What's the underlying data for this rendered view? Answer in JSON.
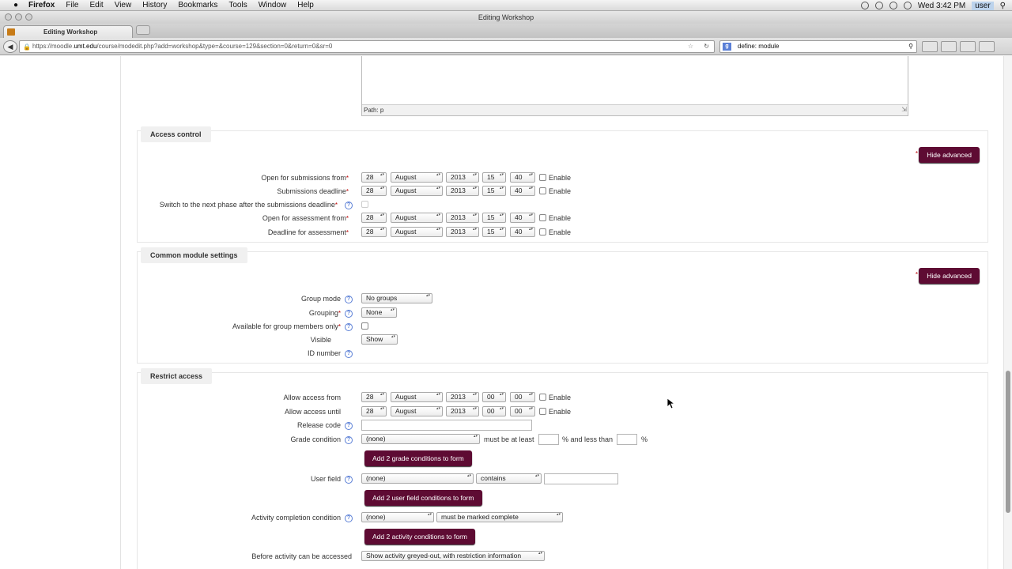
{
  "menubar": {
    "app": "Firefox",
    "items": [
      "File",
      "Edit",
      "View",
      "History",
      "Bookmarks",
      "Tools",
      "Window",
      "Help"
    ],
    "clock": "Wed 3:42 PM",
    "user": "user"
  },
  "window": {
    "title": "Editing Workshop"
  },
  "tab": {
    "title": "Editing Workshop"
  },
  "nav": {
    "url_prefix": "https://moodle.",
    "url_host": "umt.edu",
    "url_rest": "/course/modedit.php?add=workshop&type=&course=129&section=0&return=0&sr=0",
    "search_value": "define: module"
  },
  "editor": {
    "path": "Path: p"
  },
  "access_control": {
    "legend": "Access control",
    "hide_advanced": "Hide advanced",
    "rows": [
      {
        "label": "Open for submissions from",
        "day": "28",
        "month": "August",
        "year": "2013",
        "hour": "15",
        "minute": "40",
        "enable": "Enable"
      },
      {
        "label": "Submissions deadline",
        "day": "28",
        "month": "August",
        "year": "2013",
        "hour": "15",
        "minute": "40",
        "enable": "Enable"
      },
      {
        "label": "Open for assessment from",
        "day": "28",
        "month": "August",
        "year": "2013",
        "hour": "15",
        "minute": "40",
        "enable": "Enable"
      },
      {
        "label": "Deadline for assessment",
        "day": "28",
        "month": "August",
        "year": "2013",
        "hour": "15",
        "minute": "40",
        "enable": "Enable"
      }
    ],
    "switch_label": "Switch to the next phase after the submissions deadline"
  },
  "common": {
    "legend": "Common module settings",
    "hide_advanced": "Hide advanced",
    "group_mode_label": "Group mode",
    "group_mode_value": "No groups",
    "grouping_label": "Grouping",
    "grouping_value": "None",
    "members_only_label": "Available for group members only",
    "visible_label": "Visible",
    "visible_value": "Show",
    "id_number_label": "ID number"
  },
  "restrict": {
    "legend": "Restrict access",
    "from_label": "Allow access from",
    "from": {
      "day": "28",
      "month": "August",
      "year": "2013",
      "hour": "00",
      "minute": "00",
      "enable": "Enable"
    },
    "until_label": "Allow access until",
    "until": {
      "day": "28",
      "month": "August",
      "year": "2013",
      "hour": "00",
      "minute": "00",
      "enable": "Enable"
    },
    "release_code_label": "Release code",
    "grade_condition_label": "Grade condition",
    "grade_condition_value": "(none)",
    "must_be_at_least": "must be at least",
    "and_less_than": "% and less than",
    "percent": "%",
    "add_grade_button": "Add 2 grade conditions to form",
    "user_field_label": "User field",
    "user_field_value": "(none)",
    "user_field_op": "contains",
    "add_user_field_button": "Add 2 user field conditions to form",
    "activity_completion_label": "Activity completion condition",
    "activity_completion_value": "(none)",
    "activity_completion_state": "must be marked complete",
    "add_activity_button": "Add 2 activity conditions to form",
    "before_label": "Before activity can be accessed",
    "before_value": "Show activity greyed-out, with restriction information"
  }
}
